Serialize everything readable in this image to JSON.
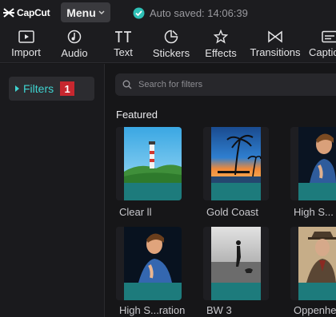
{
  "app": {
    "brand": "CapCut",
    "menu_label": "Menu",
    "autosave_text": "Auto saved: 14:06:39"
  },
  "toolbar": {
    "items": [
      {
        "label": "Import",
        "icon": "import-icon"
      },
      {
        "label": "Audio",
        "icon": "audio-icon"
      },
      {
        "label": "Text",
        "icon": "text-icon"
      },
      {
        "label": "Stickers",
        "icon": "stickers-icon"
      },
      {
        "label": "Effects",
        "icon": "effects-icon"
      },
      {
        "label": "Transitions",
        "icon": "transitions-icon"
      },
      {
        "label": "Captio",
        "icon": "captions-icon"
      }
    ]
  },
  "sidebar": {
    "items": [
      {
        "label": "Filters",
        "badge": "1",
        "selected": true
      }
    ]
  },
  "search": {
    "placeholder": "Search for filters"
  },
  "featured": {
    "title": "Featured",
    "filters": [
      {
        "name": "Clear ll"
      },
      {
        "name": "Gold Coast"
      },
      {
        "name": "High S..."
      },
      {
        "name": "High S...ration"
      },
      {
        "name": "BW 3"
      },
      {
        "name": "Oppenhe"
      }
    ]
  },
  "colors": {
    "accent": "#3fd4d1",
    "badge": "#c7272f",
    "autosave_check": "#2ec0b6",
    "card_strip": "#1d7b7c"
  }
}
